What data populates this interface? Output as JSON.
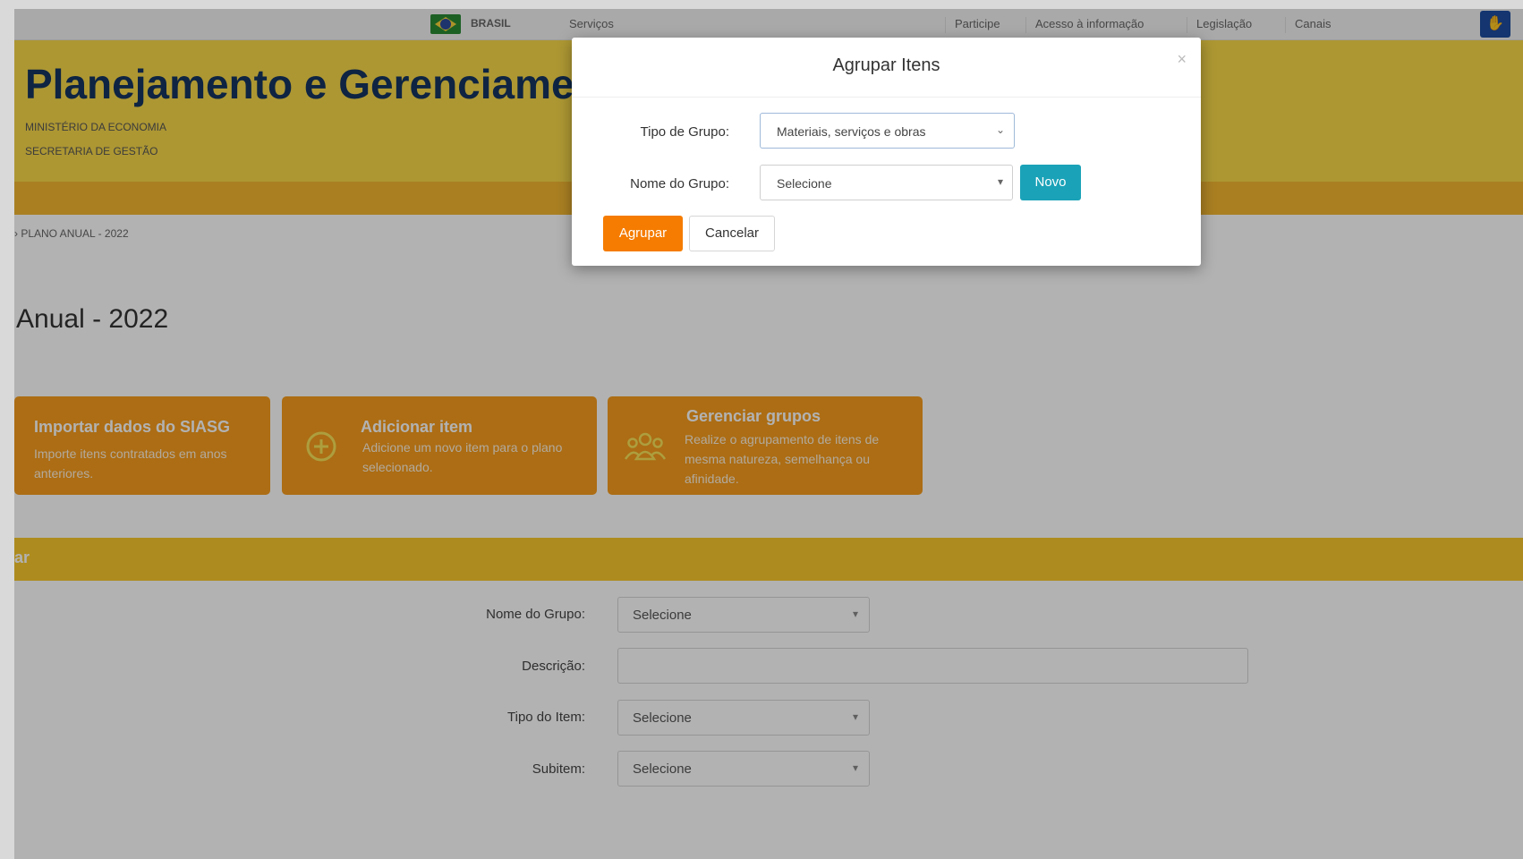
{
  "govbar": {
    "country": "BRASIL",
    "services": "Serviços",
    "links": [
      "Participe",
      "Acesso à informação",
      "Legislação",
      "Canais"
    ]
  },
  "header": {
    "title": "Planejamento e Gerenciamento de Contratações",
    "ministry": "MINISTÉRIO DA ECONOMIA",
    "secretariat": "SECRETARIA DE GESTÃO"
  },
  "breadcrumb": "› PLANO ANUAL - 2022",
  "page_title": "Anual - 2022",
  "cards": [
    {
      "title": "Importar dados do SIASG",
      "description": "Importe itens contratados em anos anteriores."
    },
    {
      "title": "Adicionar item",
      "description": "Adicione um novo item para o plano selecionado."
    },
    {
      "title": "Gerenciar grupos",
      "description": "Realize o agrupamento de itens de mesma natureza, semelhança ou afinidade."
    }
  ],
  "filter_bar": {
    "label": "ar"
  },
  "form": {
    "group_name_label": "Nome do Grupo:",
    "group_name_value": "Selecione",
    "description_label": "Descrição:",
    "description_value": "",
    "item_type_label": "Tipo do Item:",
    "item_type_value": "Selecione",
    "subitem_label": "Subitem:",
    "subitem_value": "Selecione"
  },
  "modal": {
    "title": "Agrupar Itens",
    "close": "×",
    "group_type_label": "Tipo de Grupo:",
    "group_type_value": "Materiais, serviços e obras",
    "group_name_label": "Nome do Grupo:",
    "group_name_value": "Selecione",
    "new_button": "Novo",
    "group_button": "Agrupar",
    "cancel_button": "Cancelar"
  },
  "colors": {
    "header_yellow": "#f8d84a",
    "card_orange": "#f79d1e",
    "modal_primary": "#f57c00",
    "modal_info": "#1aa2b8"
  }
}
